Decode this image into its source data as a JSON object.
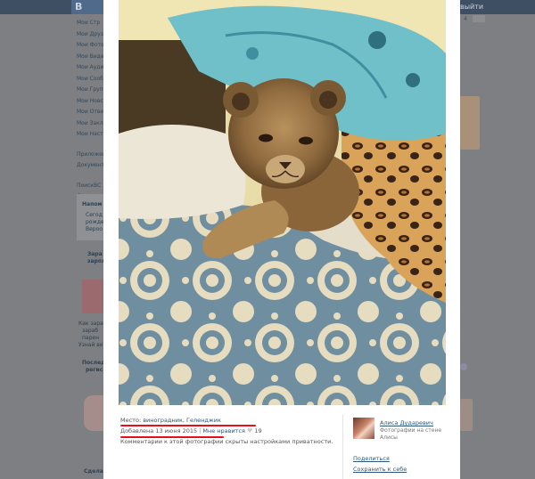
{
  "bg": {
    "logo": "В",
    "logout": "выйти",
    "menu_items": [
      "Мои Стр",
      "Мои Друз",
      "Мои Фото",
      "Мои Виде",
      "Мои Ауди",
      "Мои Сооб",
      "Мои Груп",
      "Мои Новс",
      "Мои Отве",
      "Мои Закл",
      "Мои Наст"
    ],
    "menu_items2": [
      "Приложен",
      "Документ"
    ],
    "menu_items3": [
      "ПоискВС",
      "Сердечки"
    ],
    "reminder_title": "Напом",
    "reminder_lines": [
      "Сегод",
      "рожде",
      "Вероо"
    ],
    "promo_title_lines": [
      "Зара",
      "зарпл"
    ],
    "promo_caption_lines": [
      "Как зара",
      "зараб",
      "парен",
      "Узнай ве"
    ],
    "recent_title_lines": [
      "Послед",
      "регис"
    ],
    "footer_left": "Сдела",
    "number_badge": "4"
  },
  "viewer": {
    "place_label": "Место:",
    "place_value": "виноградник, Геленджик",
    "added_label": "Добавлена 13 июня 2015",
    "likes_label": "Мне нравится",
    "likes_count": "19",
    "privacy_note": "Комментарии к этой фотографии скрыты настройками приватности.",
    "owner_name": "Алиса Дударевич",
    "owner_subtitle": "Фотографии на стене Алисы",
    "share_label": "Поделиться",
    "save_label": "Сохранить к себе"
  }
}
